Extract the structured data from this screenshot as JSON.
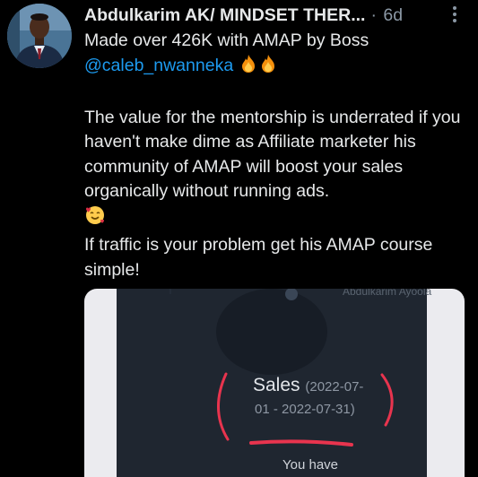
{
  "tweet": {
    "author_name": "Abdulkarim AK/ MINDSET THER...",
    "separator": "·",
    "timestamp": "6d",
    "avatar_icon": "profile-photo-icon",
    "more_icon": "more-options-icon",
    "line1": "Made over 426K with AMAP by Boss",
    "mention": "@caleb_nwanneka",
    "mention_emoji": "fire-icon",
    "paragraph2": "The value for the mentorship is underrated if you haven't make dime as Affiliate marketer his community of AMAP will boost your sales organically without running ads.",
    "paragraph2_emoji": "smiling-face-with-hearts-icon",
    "paragraph3": "If traffic is your problem get his AMAP course simple!",
    "mention_color": "#1d9bf0",
    "background_color": "#000000"
  },
  "media": {
    "sales_label": "Sales",
    "range_part1": "(2022-07-",
    "range_part2": "01 - 2022-07-31)",
    "you_have": "You have",
    "blurred_name": "Abdulkarim Ayoola",
    "annotation_color": "#e8344e"
  }
}
